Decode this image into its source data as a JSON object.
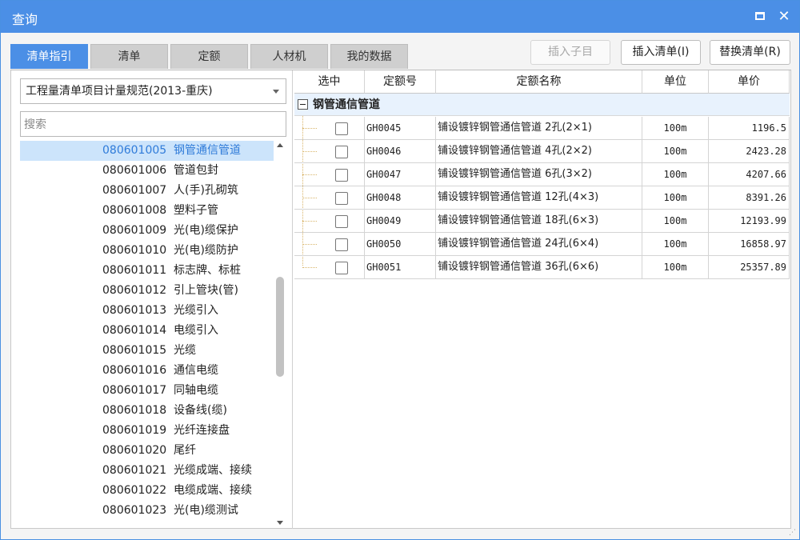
{
  "window": {
    "title": "查询"
  },
  "tabs": [
    {
      "label": "清单指引",
      "active": true
    },
    {
      "label": "清单",
      "active": false
    },
    {
      "label": "定额",
      "active": false
    },
    {
      "label": "人材机",
      "active": false
    },
    {
      "label": "我的数据",
      "active": false
    }
  ],
  "toolbar": {
    "insert_child": "插入子目",
    "insert_list": "插入清单(I)",
    "replace_list": "替换清单(R)"
  },
  "left": {
    "dropdown_value": "工程量清单项目计量规范(2013-重庆)",
    "search_placeholder": "搜索",
    "items": [
      {
        "code": "080601005",
        "name": "钢管通信管道",
        "selected": true
      },
      {
        "code": "080601006",
        "name": "管道包封"
      },
      {
        "code": "080601007",
        "name": "人(手)孔砌筑"
      },
      {
        "code": "080601008",
        "name": "塑料子管"
      },
      {
        "code": "080601009",
        "name": "光(电)缆保护"
      },
      {
        "code": "080601010",
        "name": "光(电)缆防护"
      },
      {
        "code": "080601011",
        "name": "标志牌、标桩"
      },
      {
        "code": "080601012",
        "name": "引上管块(管)"
      },
      {
        "code": "080601013",
        "name": "光缆引入"
      },
      {
        "code": "080601014",
        "name": "电缆引入"
      },
      {
        "code": "080601015",
        "name": "光缆"
      },
      {
        "code": "080601016",
        "name": "通信电缆"
      },
      {
        "code": "080601017",
        "name": "同轴电缆"
      },
      {
        "code": "080601018",
        "name": "设备线(缆)"
      },
      {
        "code": "080601019",
        "name": "光纤连接盘"
      },
      {
        "code": "080601020",
        "name": "尾纤"
      },
      {
        "code": "080601021",
        "name": "光缆成端、接续"
      },
      {
        "code": "080601022",
        "name": "电缆成端、接续"
      },
      {
        "code": "080601023",
        "name": "光(电)缆测试"
      }
    ]
  },
  "grid": {
    "headers": {
      "select": "选中",
      "code": "定额号",
      "name": "定额名称",
      "unit": "单位",
      "price": "单价"
    },
    "group": "钢管通信管道",
    "rows": [
      {
        "code": "GH0045",
        "name": "铺设镀锌钢管通信管道 2孔(2×1)",
        "unit": "100m",
        "price": "1196.5"
      },
      {
        "code": "GH0046",
        "name": "铺设镀锌钢管通信管道 4孔(2×2)",
        "unit": "100m",
        "price": "2423.28"
      },
      {
        "code": "GH0047",
        "name": "铺设镀锌钢管通信管道 6孔(3×2)",
        "unit": "100m",
        "price": "4207.66"
      },
      {
        "code": "GH0048",
        "name": "铺设镀锌钢管通信管道 12孔(4×3)",
        "unit": "100m",
        "price": "8391.26"
      },
      {
        "code": "GH0049",
        "name": "铺设镀锌钢管通信管道 18孔(6×3)",
        "unit": "100m",
        "price": "12193.99"
      },
      {
        "code": "GH0050",
        "name": "铺设镀锌钢管通信管道 24孔(6×4)",
        "unit": "100m",
        "price": "16858.97"
      },
      {
        "code": "GH0051",
        "name": "铺设镀锌钢管通信管道 36孔(6×6)",
        "unit": "100m",
        "price": "25357.89"
      }
    ]
  },
  "colors": {
    "accent": "#4b8fe6",
    "selected_bg": "#cce4fb",
    "selected_text": "#2f7bd9",
    "group_bg": "#e8f2fd"
  }
}
